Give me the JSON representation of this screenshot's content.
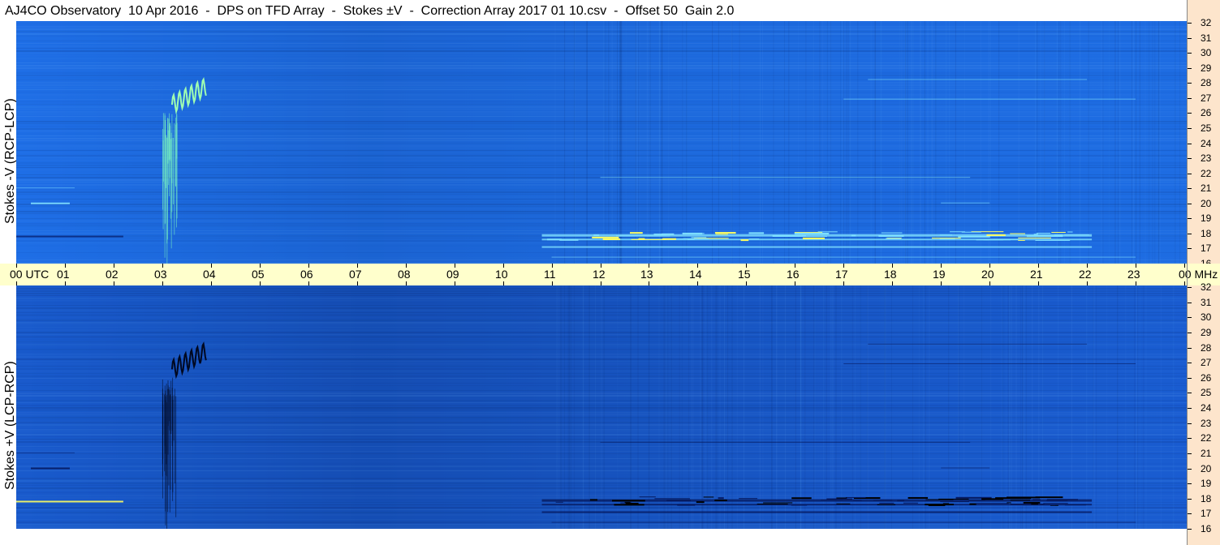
{
  "title": "AJ4CO Observatory  10 Apr 2016  -  DPS on TFD Array  -  Stokes ±V  -  Correction Array 2017 01 10.csv  -  Offset 50  Gain 2.0",
  "chart_data": [
    {
      "type": "heatmap",
      "panel": "top",
      "ylabel": "Stokes -V (RCP-LCP)",
      "x_ticks": [
        "00 UTC",
        "01",
        "02",
        "03",
        "04",
        "05",
        "06",
        "07",
        "08",
        "09",
        "10",
        "11",
        "12",
        "13",
        "14",
        "15",
        "16",
        "17",
        "18",
        "19",
        "20",
        "21",
        "22",
        "23",
        "00 MHz"
      ],
      "x_range_hours": [
        0,
        24
      ],
      "y_ticks": [
        "32",
        "31",
        "30",
        "29",
        "28",
        "27",
        "26",
        "25",
        "24",
        "23",
        "22",
        "21",
        "20",
        "19",
        "18",
        "17",
        "16"
      ],
      "y_range_mhz": [
        16,
        32
      ],
      "colors": {
        "background": "#1e6ee6",
        "high": "#7fe0ff",
        "peak": "#ffff60",
        "low": "#0a2a80"
      }
    },
    {
      "type": "heatmap",
      "panel": "bottom",
      "ylabel": "Stokes +V (LCP-RCP)",
      "y_ticks": [
        "32",
        "31",
        "30",
        "29",
        "28",
        "27",
        "26",
        "25",
        "24",
        "23",
        "22",
        "21",
        "20",
        "19",
        "18",
        "17",
        "16"
      ],
      "y_range_mhz": [
        16,
        32
      ],
      "colors": {
        "background": "#1a5ed4",
        "high": "#7fe0ff",
        "peak": "#ffff60",
        "low": "#061a60"
      }
    }
  ],
  "time_axis": {
    "labels": [
      "00 UTC",
      "01",
      "02",
      "03",
      "04",
      "05",
      "06",
      "07",
      "08",
      "09",
      "10",
      "11",
      "12",
      "13",
      "14",
      "15",
      "16",
      "17",
      "18",
      "19",
      "20",
      "21",
      "22",
      "23",
      "00 MHz"
    ]
  }
}
